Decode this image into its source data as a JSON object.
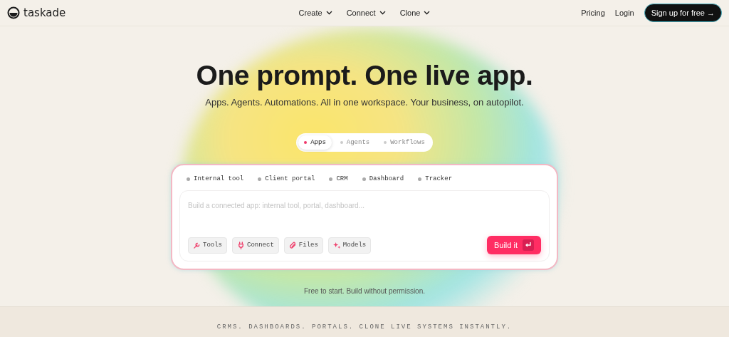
{
  "nav": {
    "brand": "taskade",
    "menus": [
      {
        "label": "Create"
      },
      {
        "label": "Connect"
      },
      {
        "label": "Clone"
      }
    ],
    "links": [
      "Pricing",
      "Login"
    ],
    "cta": "Sign up for free →"
  },
  "hero": {
    "title": "One prompt. One live app.",
    "subtitle": "Apps. Agents. Automations. All in one workspace. Your business, on autopilot."
  },
  "tabs": [
    {
      "label": "Apps",
      "selected": true
    },
    {
      "label": "Agents",
      "selected": false
    },
    {
      "label": "Workflows",
      "selected": false
    }
  ],
  "prompt": {
    "suggestions": [
      "Internal tool",
      "Client portal",
      "CRM",
      "Dashboard",
      "Tracker"
    ],
    "placeholder": "Build a connected app: internal tool, portal, dashboard...",
    "tools": [
      {
        "kind": "wrench",
        "label": "Tools"
      },
      {
        "kind": "plug",
        "label": "Connect"
      },
      {
        "kind": "clip",
        "label": "Files"
      },
      {
        "kind": "sparkle",
        "label": "Models"
      }
    ],
    "submit": "Build it"
  },
  "note": "Free to start. Build without permission.",
  "banner": "CRMS. DASHBOARDS. PORTALS. CLONE LIVE SYSTEMS INSTANTLY."
}
